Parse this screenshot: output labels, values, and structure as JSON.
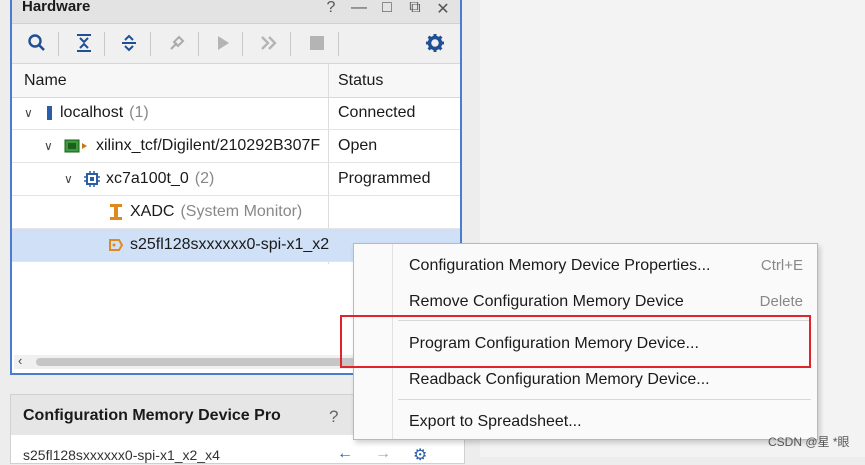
{
  "hardware": {
    "title": "Hardware",
    "controls": [
      "?",
      "—",
      "□",
      "⧉",
      "✕"
    ],
    "toolbar_icons": [
      "search-icon",
      "collapse-all-icon",
      "expand-all-icon",
      "auto-connect-icon",
      "run-icon",
      "skip-icon",
      "stop-icon",
      "gear-icon"
    ],
    "columns": {
      "name": "Name",
      "status": "Status"
    },
    "rows": [
      {
        "label": "localhost",
        "count": "(1)",
        "status": "Connected"
      },
      {
        "label": "xilinx_tcf/Digilent/210292B307F",
        "count": "",
        "status": "Open"
      },
      {
        "label": "xc7a100t_0",
        "count": "(2)",
        "status": "Programmed"
      },
      {
        "label": "XADC",
        "count": "(System Monitor)",
        "status": ""
      },
      {
        "label": "s25fl128sxxxxxx0-spi-x1_x2",
        "count": "",
        "status": ""
      }
    ]
  },
  "config_panel": {
    "title": "Configuration Memory Device Pro",
    "help": "?",
    "row_label": "s25fl128sxxxxxx0-spi-x1_x2_x4"
  },
  "context_menu": {
    "items": [
      {
        "label": "Configuration Memory Device Properties...",
        "shortcut": "Ctrl+E"
      },
      {
        "label": "Remove Configuration Memory Device",
        "shortcut": "Delete"
      },
      {
        "label": "Program Configuration Memory Device...",
        "shortcut": ""
      },
      {
        "label": "Readback Configuration Memory Device...",
        "shortcut": ""
      },
      {
        "label": "Export to Spreadsheet...",
        "shortcut": ""
      }
    ]
  },
  "colors": {
    "selection": "#cfe0f7",
    "accent": "#2a5ea8",
    "highlight": "#e0242c"
  },
  "watermark": "CSDN @星 *眼"
}
